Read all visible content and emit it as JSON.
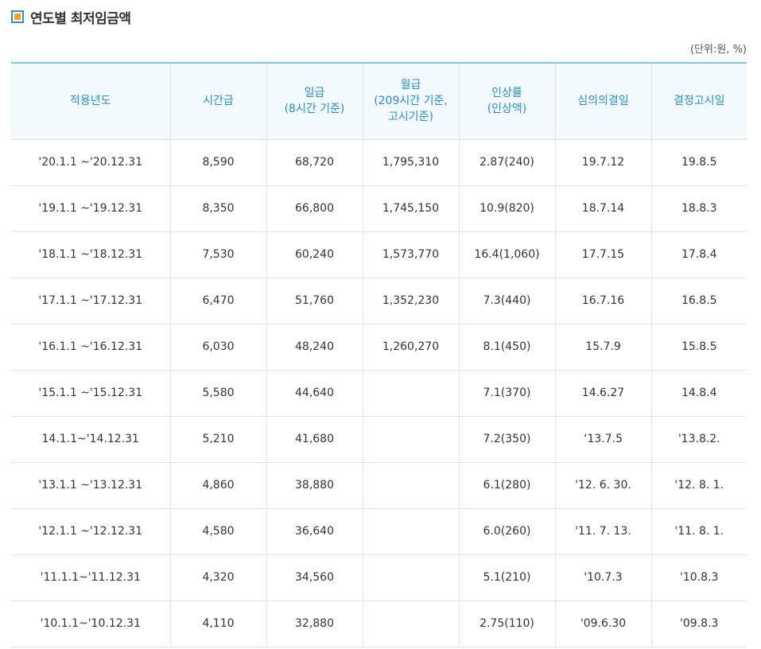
{
  "page": {
    "title": "연도별 최저임금액",
    "unit_note": "(단위:원, %)"
  },
  "table": {
    "headers": [
      {
        "lines": [
          "적용년도"
        ]
      },
      {
        "lines": [
          "시간급"
        ]
      },
      {
        "lines": [
          "일급",
          "(8시간 기준)"
        ]
      },
      {
        "lines": [
          "월급",
          "(209시간 기준,",
          "고시기준)"
        ]
      },
      {
        "lines": [
          "인상률",
          "(인상액)"
        ]
      },
      {
        "lines": [
          "심의의결일"
        ]
      },
      {
        "lines": [
          "결정고시일"
        ]
      }
    ],
    "rows": [
      [
        "'20.1.1 ~'20.12.31",
        "8,590",
        "68,720",
        "1,795,310",
        "2.87(240)",
        "19.7.12",
        "19.8.5"
      ],
      [
        "'19.1.1 ~'19.12.31",
        "8,350",
        "66,800",
        "1,745,150",
        "10.9(820)",
        "18.7.14",
        "18.8.3"
      ],
      [
        "'18.1.1 ~'18.12.31",
        "7,530",
        "60,240",
        "1,573,770",
        "16.4(1,060)",
        "17.7.15",
        "17.8.4"
      ],
      [
        "'17.1.1 ~'17.12.31",
        "6,470",
        "51,760",
        "1,352,230",
        "7.3(440)",
        "16.7.16",
        "16.8.5"
      ],
      [
        "'16.1.1 ~'16.12.31",
        "6,030",
        "48,240",
        "1,260,270",
        "8.1(450)",
        "15.7.9",
        "15.8.5"
      ],
      [
        "'15.1.1 ~'15.12.31",
        "5,580",
        "44,640",
        "",
        "7.1(370)",
        "14.6.27",
        "14.8.4"
      ],
      [
        "14.1.1~'14.12.31",
        "5,210",
        "41,680",
        "",
        "7.2(350)",
        "‘13.7.5",
        "'13.8.2."
      ],
      [
        "'13.1.1 ~'13.12.31",
        "4,860",
        "38,880",
        "",
        "6.1(280)",
        "'12. 6. 30.",
        "'12. 8. 1."
      ],
      [
        "'12.1.1 ~'12.12.31",
        "4,580",
        "36,640",
        "",
        "6.0(260)",
        "'11. 7. 13.",
        "'11. 8. 1."
      ],
      [
        "'11.1.1~'11.12.31",
        "4,320",
        "34,560",
        "",
        "5.1(210)",
        "'10.7.3",
        "'10.8.3"
      ],
      [
        "'10.1.1~'10.12.31",
        "4,110",
        "32,880",
        "",
        "2.75(110)",
        "'09.6.30",
        "'09.8.3"
      ]
    ]
  }
}
